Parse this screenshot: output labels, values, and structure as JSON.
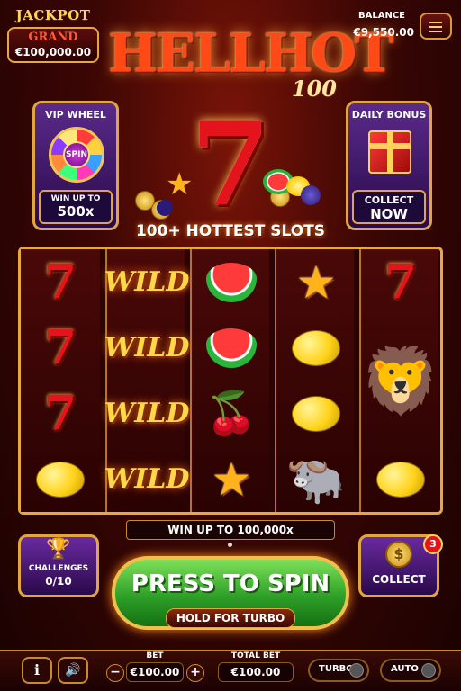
{
  "jackpot": {
    "title": "JACKPOT",
    "tier": "GRAND",
    "amount": "€100,000.00"
  },
  "balance": {
    "label": "BALANCE",
    "value": "€9,550.00"
  },
  "logo": {
    "main": "HELLHOT",
    "sub": "100"
  },
  "vip_wheel": {
    "title": "VIP WHEEL",
    "spin": "SPIN",
    "win_label": "WIN UP TO",
    "win_value": "500x"
  },
  "daily_bonus": {
    "title": "DAILY BONUS",
    "cta_top": "COLLECT",
    "cta_bottom": "NOW"
  },
  "big_symbol": "7",
  "subtitle": "100+ HOTTEST SLOTS",
  "reels": [
    [
      "seven",
      "seven",
      "seven",
      "lemon"
    ],
    [
      "wild",
      "wild",
      "wild",
      "wild"
    ],
    [
      "melon",
      "melon",
      "cherry",
      "star"
    ],
    [
      "star",
      "lemon",
      "lemon",
      "buffalo"
    ],
    [
      "seven",
      "lion",
      "lion",
      "lemon"
    ]
  ],
  "symbol_glyphs": {
    "seven": "7",
    "wild": "WILD",
    "star": "★",
    "cherry": "🍒",
    "lion": "🦁",
    "buffalo": "🐃"
  },
  "win_banner": "WIN UP TO 100,000x",
  "challenges": {
    "label": "CHALLENGES",
    "progress": "0/10",
    "icon": "trophy-icon"
  },
  "collect": {
    "label": "COLLECT",
    "badge": "3",
    "coin_symbol": "$"
  },
  "spin_button": {
    "label": "PRESS TO SPIN",
    "sublabel": "HOLD FOR TURBO"
  },
  "bottom_bar": {
    "info_label": "i",
    "sound_label": "🔊",
    "bet_label": "BET",
    "bet_value": "€100.00",
    "minus": "−",
    "plus": "+",
    "total_bet_label": "TOTAL BET",
    "total_bet_value": "€100.00",
    "turbo_label": "TURBO",
    "auto_label": "AUTO"
  },
  "colors": {
    "accent_gold": "#e8a93c",
    "spin_green": "#2ea028",
    "panel_purple": "#5a2a8a",
    "seven_red": "#e3141c"
  }
}
